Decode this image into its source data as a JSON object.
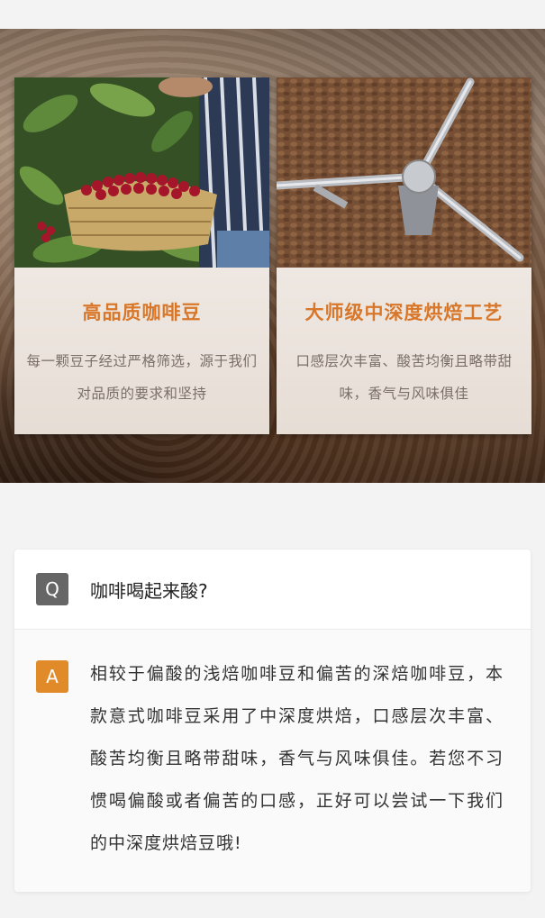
{
  "features": [
    {
      "title": "高品质咖啡豆",
      "description": "每一颗豆子经过严格筛选，源于我们对品质的要求和坚持",
      "photo_icon": "coffee-cherry-harvest-photo"
    },
    {
      "title": "大师级中深度烘焙工艺",
      "description": "口感层次丰富、酸苦均衡且略带甜味，香气与风味俱佳",
      "photo_icon": "coffee-roaster-photo"
    }
  ],
  "faq": {
    "q_badge": "Q",
    "question": "咖啡喝起来酸?",
    "a_badge": "A",
    "answer": "相较于偏酸的浅焙咖啡豆和偏苦的深焙咖啡豆，本款意式咖啡豆采用了中深度烘焙，口感层次丰富、酸苦均衡且略带甜味，香气与风味俱佳。若您不习惯喝偏酸或者偏苦的口感，正好可以尝试一下我们的中深度烘焙豆哦!"
  },
  "colors": {
    "accent": "#d8772a",
    "answer_badge": "#e08a2a",
    "question_badge": "#666666"
  }
}
